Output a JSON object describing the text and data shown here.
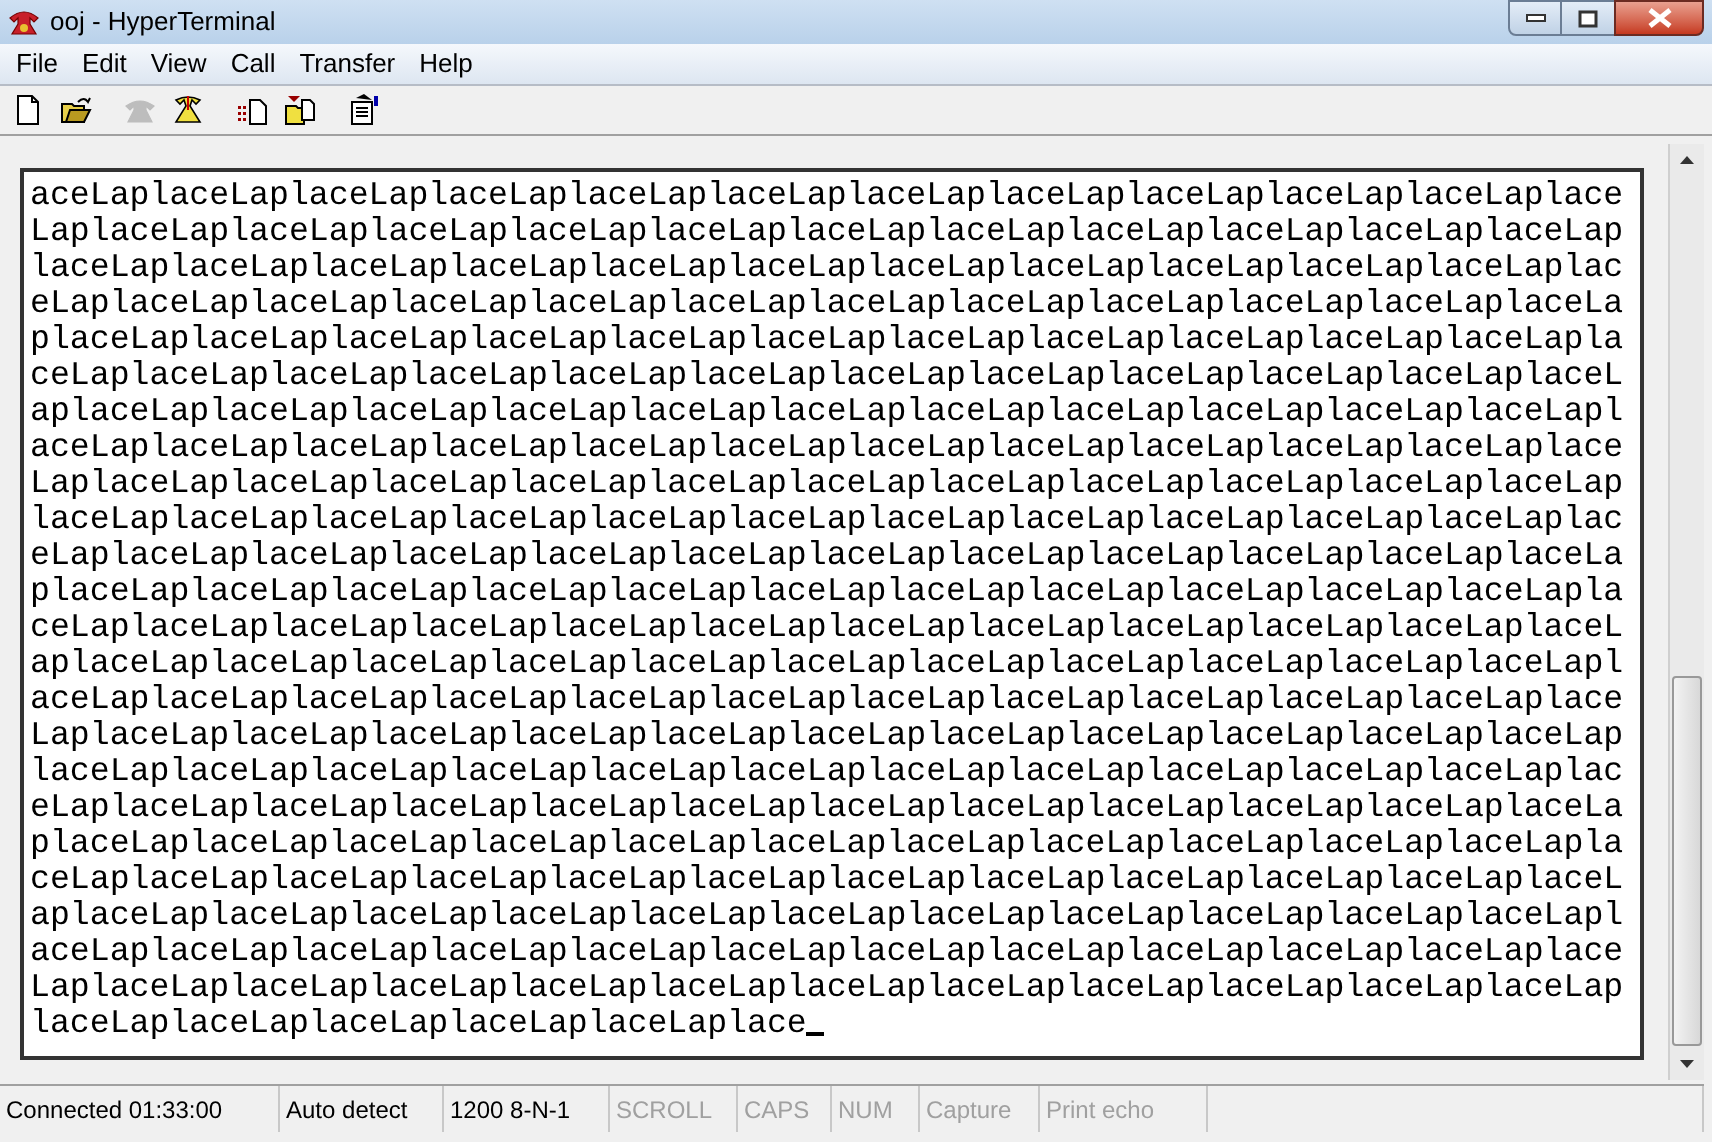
{
  "window": {
    "title": "ooj - HyperTerminal"
  },
  "menu": [
    "File",
    "Edit",
    "View",
    "Call",
    "Transfer",
    "Help"
  ],
  "toolbar": [
    {
      "kind": "new",
      "disabled": false
    },
    {
      "kind": "open",
      "disabled": false
    },
    {
      "kind": "dial",
      "disabled": true
    },
    {
      "kind": "hangup",
      "disabled": false
    },
    {
      "kind": "send",
      "disabled": false
    },
    {
      "kind": "receive",
      "disabled": false
    },
    {
      "kind": "properties",
      "disabled": false
    }
  ],
  "terminal": {
    "lines": [
      "aceLaplaceLaplaceLaplaceLaplaceLaplaceLaplaceLaplaceLaplaceLaplaceLaplaceLaplace",
      "LaplaceLaplaceLaplaceLaplaceLaplaceLaplaceLaplaceLaplaceLaplaceLaplaceLaplaceLap",
      "laceLaplaceLaplaceLaplaceLaplaceLaplaceLaplaceLaplaceLaplaceLaplaceLaplaceLaplac",
      "eLaplaceLaplaceLaplaceLaplaceLaplaceLaplaceLaplaceLaplaceLaplaceLaplaceLaplaceLa",
      "placeLaplaceLaplaceLaplaceLaplaceLaplaceLaplaceLaplaceLaplaceLaplaceLaplaceLapla",
      "ceLaplaceLaplaceLaplaceLaplaceLaplaceLaplaceLaplaceLaplaceLaplaceLaplaceLaplaceL",
      "aplaceLaplaceLaplaceLaplaceLaplaceLaplaceLaplaceLaplaceLaplaceLaplaceLaplaceLapl",
      "aceLaplaceLaplaceLaplaceLaplaceLaplaceLaplaceLaplaceLaplaceLaplaceLaplaceLaplace",
      "LaplaceLaplaceLaplaceLaplaceLaplaceLaplaceLaplaceLaplaceLaplaceLaplaceLaplaceLap",
      "laceLaplaceLaplaceLaplaceLaplaceLaplaceLaplaceLaplaceLaplaceLaplaceLaplaceLaplac",
      "eLaplaceLaplaceLaplaceLaplaceLaplaceLaplaceLaplaceLaplaceLaplaceLaplaceLaplaceLa",
      "placeLaplaceLaplaceLaplaceLaplaceLaplaceLaplaceLaplaceLaplaceLaplaceLaplaceLapla",
      "ceLaplaceLaplaceLaplaceLaplaceLaplaceLaplaceLaplaceLaplaceLaplaceLaplaceLaplaceL",
      "aplaceLaplaceLaplaceLaplaceLaplaceLaplaceLaplaceLaplaceLaplaceLaplaceLaplaceLapl",
      "aceLaplaceLaplaceLaplaceLaplaceLaplaceLaplaceLaplaceLaplaceLaplaceLaplaceLaplace",
      "LaplaceLaplaceLaplaceLaplaceLaplaceLaplaceLaplaceLaplaceLaplaceLaplaceLaplaceLap",
      "laceLaplaceLaplaceLaplaceLaplaceLaplaceLaplaceLaplaceLaplaceLaplaceLaplaceLaplac",
      "eLaplaceLaplaceLaplaceLaplaceLaplaceLaplaceLaplaceLaplaceLaplaceLaplaceLaplaceLa",
      "placeLaplaceLaplaceLaplaceLaplaceLaplaceLaplaceLaplaceLaplaceLaplaceLaplaceLapla",
      "ceLaplaceLaplaceLaplaceLaplaceLaplaceLaplaceLaplaceLaplaceLaplaceLaplaceLaplaceL",
      "aplaceLaplaceLaplaceLaplaceLaplaceLaplaceLaplaceLaplaceLaplaceLaplaceLaplaceLapl",
      "aceLaplaceLaplaceLaplaceLaplaceLaplaceLaplaceLaplaceLaplaceLaplaceLaplaceLaplace",
      "LaplaceLaplaceLaplaceLaplaceLaplaceLaplaceLaplaceLaplaceLaplaceLaplaceLaplaceLap",
      "laceLaplaceLaplaceLaplaceLaplaceLaplace"
    ]
  },
  "status_bar": [
    {
      "text": "Connected 01:33:00",
      "disabled": false
    },
    {
      "text": "Auto detect",
      "disabled": false
    },
    {
      "text": "1200 8-N-1",
      "disabled": false
    },
    {
      "text": "SCROLL",
      "disabled": true
    },
    {
      "text": "CAPS",
      "disabled": true
    },
    {
      "text": "NUM",
      "disabled": true
    },
    {
      "text": "Capture",
      "disabled": true
    },
    {
      "text": "Print echo",
      "disabled": true
    }
  ]
}
